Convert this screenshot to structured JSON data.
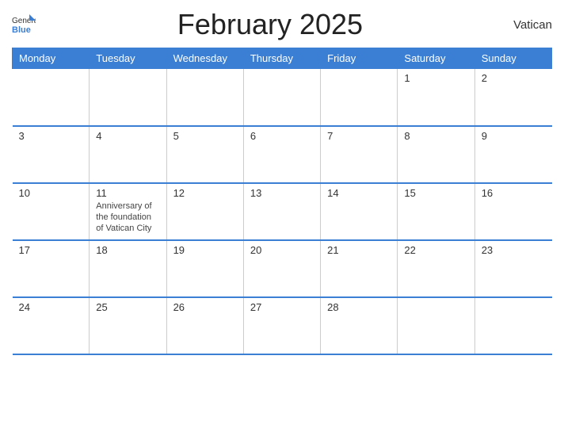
{
  "header": {
    "title": "February 2025",
    "country": "Vatican",
    "logo": {
      "general": "General",
      "blue": "Blue"
    }
  },
  "weekdays": [
    "Monday",
    "Tuesday",
    "Wednesday",
    "Thursday",
    "Friday",
    "Saturday",
    "Sunday"
  ],
  "weeks": [
    [
      {
        "day": "",
        "event": ""
      },
      {
        "day": "",
        "event": ""
      },
      {
        "day": "",
        "event": ""
      },
      {
        "day": "",
        "event": ""
      },
      {
        "day": "",
        "event": ""
      },
      {
        "day": "1",
        "event": ""
      },
      {
        "day": "2",
        "event": ""
      }
    ],
    [
      {
        "day": "3",
        "event": ""
      },
      {
        "day": "4",
        "event": ""
      },
      {
        "day": "5",
        "event": ""
      },
      {
        "day": "6",
        "event": ""
      },
      {
        "day": "7",
        "event": ""
      },
      {
        "day": "8",
        "event": ""
      },
      {
        "day": "9",
        "event": ""
      }
    ],
    [
      {
        "day": "10",
        "event": ""
      },
      {
        "day": "11",
        "event": "Anniversary of the foundation of Vatican City"
      },
      {
        "day": "12",
        "event": ""
      },
      {
        "day": "13",
        "event": ""
      },
      {
        "day": "14",
        "event": ""
      },
      {
        "day": "15",
        "event": ""
      },
      {
        "day": "16",
        "event": ""
      }
    ],
    [
      {
        "day": "17",
        "event": ""
      },
      {
        "day": "18",
        "event": ""
      },
      {
        "day": "19",
        "event": ""
      },
      {
        "day": "20",
        "event": ""
      },
      {
        "day": "21",
        "event": ""
      },
      {
        "day": "22",
        "event": ""
      },
      {
        "day": "23",
        "event": ""
      }
    ],
    [
      {
        "day": "24",
        "event": ""
      },
      {
        "day": "25",
        "event": ""
      },
      {
        "day": "26",
        "event": ""
      },
      {
        "day": "27",
        "event": ""
      },
      {
        "day": "28",
        "event": ""
      },
      {
        "day": "",
        "event": ""
      },
      {
        "day": "",
        "event": ""
      }
    ]
  ]
}
